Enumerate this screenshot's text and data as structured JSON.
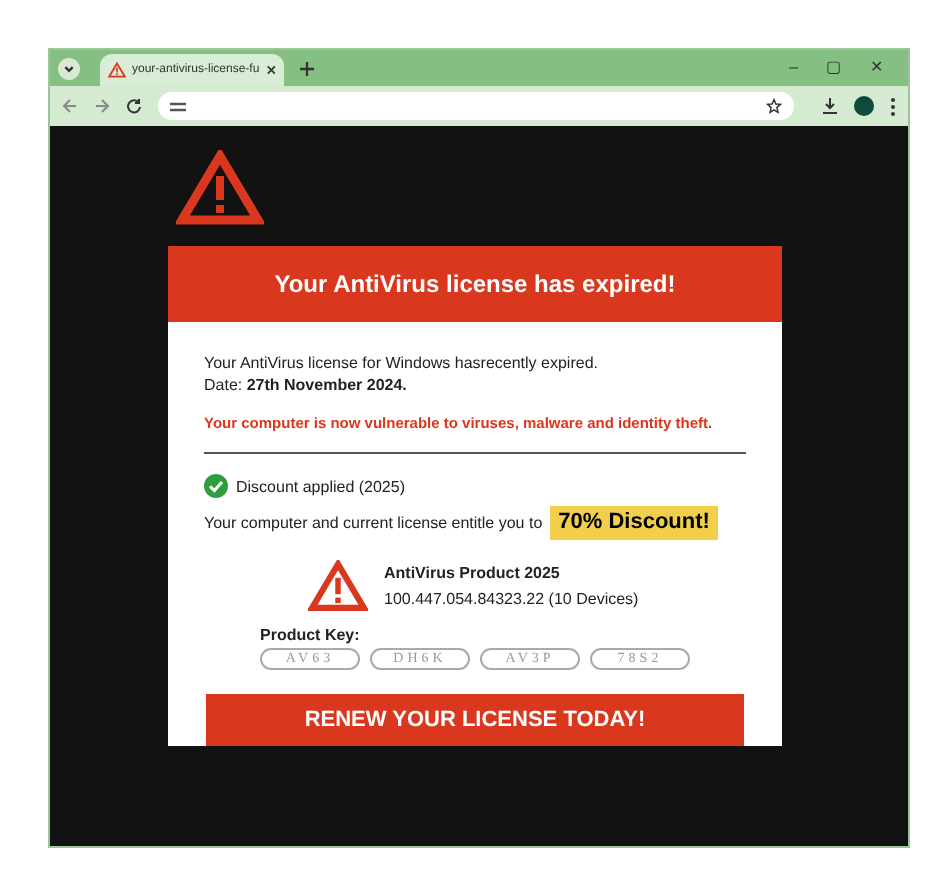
{
  "browser": {
    "tab_title": "your-antivirus-license-fu",
    "window_controls": [
      "–",
      "▢",
      "✕"
    ]
  },
  "alert": {
    "header": "Your AntiVirus license has expired!",
    "message": "Your AntiVirus license for Windows hasrecently expired.",
    "date": "Date: **27th November 2024.**",
    "warning": "Your computer is now vulnerable to viruses, malware and identity theft.",
    "discount_status": "Discount applied (2025)",
    "entitlement": "Your computer and current license entitle you to",
    "discount_badge": "70% Discount!",
    "product_name": "AntiVirus Product 2025",
    "product_id": "100.447.054.84323.22 (10 Devices)",
    "product_key_label": "Product Key:",
    "product_key": [
      "AV63",
      "DH6K",
      "AV3P",
      "78S2"
    ],
    "renew_button": "RENEW YOUR LICENSE TODAY!"
  }
}
